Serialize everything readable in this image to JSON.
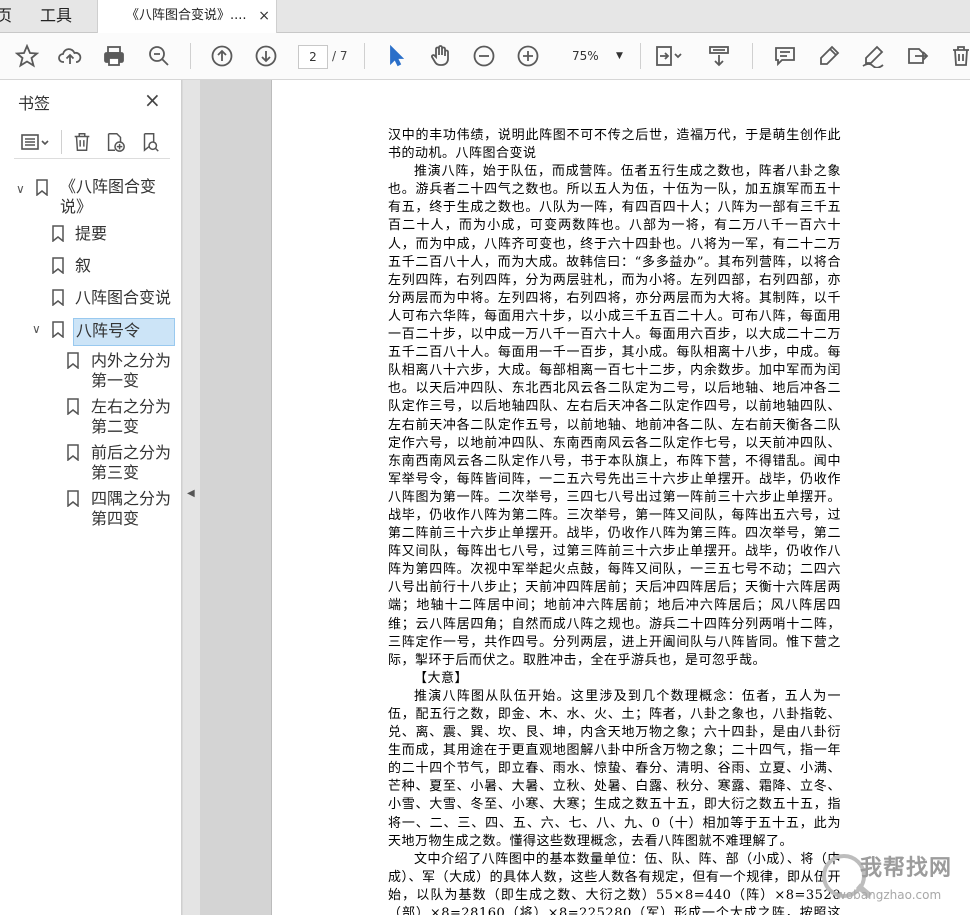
{
  "tabs": {
    "home": "页",
    "tools": "工具",
    "doc": "《八阵图合变说》....",
    "close": "×"
  },
  "toolbar": {
    "page_current": "2",
    "page_total": "/ 7",
    "zoom": "75%",
    "icons": [
      "star-icon",
      "cloud-upload-icon",
      "print-icon",
      "zoom-search-icon",
      "page-up-icon",
      "page-down-icon",
      "select-arrow-icon",
      "hand-icon",
      "zoom-out-icon",
      "zoom-in-icon",
      "fit-page-icon",
      "scroll-mode-icon",
      "comment-icon",
      "highlight-icon",
      "sign-icon",
      "export-icon",
      "delete-icon"
    ]
  },
  "sidebar": {
    "title": "书签",
    "close": "×",
    "bookmarks": [
      {
        "label": "《八阵图合变",
        "label2": "说》"
      },
      {
        "label": "提要"
      },
      {
        "label": "叙"
      },
      {
        "label": "八阵图合变说"
      },
      {
        "label": "八阵号令"
      },
      {
        "label": "内外之分为",
        "label2": "第一变"
      },
      {
        "label": "左右之分为",
        "label2": "第二变"
      },
      {
        "label": "前后之分为",
        "label2": "第三变"
      },
      {
        "label": "四隅之分为",
        "label2": "第四变"
      }
    ]
  },
  "document": {
    "paragraphs": [
      {
        "indent": false,
        "text": "汉中的丰功伟绩，说明此阵图不可不传之后世，造福万代，于是萌生创作此书的动机。八阵图合变说"
      },
      {
        "indent": true,
        "text": "推演八阵，始于队伍，而成营阵。伍者五行生成之数也，阵者八卦之象也。游兵者二十四气之数也。所以五人为伍，十伍为一队，加五旗军而五十有五，终于生成之数也。八队为一阵，有四百四十人；八阵为一部有三千五百二十人，而为小成，可变两数阵也。八部为一将，有二万八千一百六十人，而为中成，八阵齐可变也，终于六十四卦也。八将为一军，有二十二万五千二百八十人，而为大成。故韩信曰：“多多益办”。其布列营阵，以将合左列四阵，右列四阵，分为两层驻札，而为小将。左列四部，右列四部，亦分两层而为中将。左列四将，右列四将，亦分两层而为大将。其制阵，以千人可布六华阵，每面用六十步，以小成三千五百二十人。可布八阵，每面用一百二十步，以中成一万八千一百六十人。每面用六百步，以大成二十二万五千二百八十人。每面用一千一百步，其小成。每队相离十八步，中成。每队相离八十六步，大成。每部相离一百七十二步，内余数步。加中军而为闰也。以天后冲四队、东北西北风云各二队定为二号，以后地轴、地后冲各二队定作三号，以后地轴四队、左右后天冲各二队定作四号，以前地轴四队、左右前天冲各二队定作五号，以前地轴、地前冲各二队、左右前天衡各二队定作六号，以地前冲四队、东南西南风云各二队定作七号，以天前冲四队、东南西南风云各二队定作八号，书于本队旗上，布阵下营，不得错乱。闻中军举号令，每阵皆间阵，一二五六号先出三十六步止单摆开。战毕，仍收作八阵图为第一阵。二次举号，三四七八号出过第一阵前三十六步止单摆开。战毕，仍收作八阵为第二阵。三次举号，第一阵又间队，每阵出五六号，过第二阵前三十六步止单摆开。战毕，仍收作八阵为第三阵。四次举号，第二阵又间队，每阵出七八号，过第三阵前三十六步止单摆开。战毕，仍收作八阵为第四阵。次视中军举起火点鼓，每阵又间队，一三五七号不动；二四六八号出前行十八步止；天前冲四阵居前；天后冲四阵居后；天衡十六阵居两端；地轴十二阵居中间；地前冲六阵居前；地后冲六阵居后；风八阵居四维；云八阵居四角；自然而成八阵之规也。游兵二十四阵分列两哨十二阵，三阵定作一号，共作四号。分列两层，进上开阖间队与八阵皆同。惟下营之际，掣环于后而伏之。取胜冲击，全在乎游兵也，是可忽乎哉。"
      },
      {
        "indent": true,
        "text": "【大意】"
      },
      {
        "indent": true,
        "text": "推演八阵图从队伍开始。这里涉及到几个数理概念：伍者，五人为一伍，配五行之数，即金、木、水、火、土；阵者，八卦之象也，八卦指乾、兑、离、震、巽、坎、艮、坤，内含天地万物之象；六十四卦，是由八卦衍生而成，其用途在于更直观地图解八卦中所含万物之象；二十四气，指一年的二十四个节气，即立春、雨水、惊蛰、春分、清明、谷雨、立夏、小满、芒种、夏至、小暑、大暑、立秋、处暑、白露、秋分、寒露、霜降、立冬、小雪、大雪、冬至、小寒、大寒；生成之数五十五，即大衍之数五十五，指将一、二、三、四、五、六、七、八、九、0（十）相加等于五十五，此为天地万物生成之数。懂得这些数理概念，去看八阵图就不难理解了。"
      },
      {
        "indent": true,
        "text": "文中介绍了八阵图中的基本数量单位：伍、队、阵、部（小成）、将（中成）、军（大成）的具体人数，这些人数各有规定，但有一个规律，即从伍开始，以队为基数（即生成之数、大衍之数）55×8=440（阵）×8=3520（部）×8=28160（将）×8=225280（军）形成一个大成之阵，按照这个规律还可以"
      }
    ]
  },
  "watermark": {
    "text": "我帮找网",
    "url": "wobangzhao.com"
  },
  "colors": {
    "selected_bookmark_bg": "#cce4f7",
    "doc_bg": "#d4d4d4",
    "page_bg": "#ffffff"
  }
}
